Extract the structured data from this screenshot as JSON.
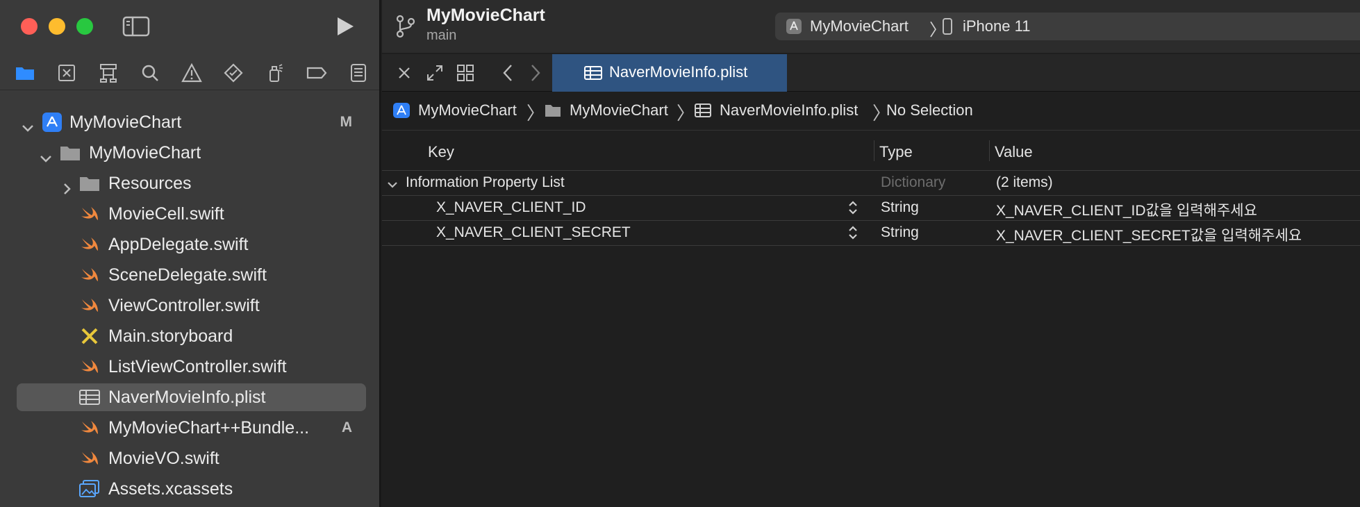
{
  "sidebar": {
    "nav_icons": [
      "folder-icon",
      "source-control-icon",
      "hierarchy-icon",
      "search-icon",
      "warning-icon",
      "test-diamond-icon",
      "debug-spray-icon",
      "breakpoint-icon",
      "report-icon"
    ],
    "tree": [
      {
        "label": "MyMovieChart",
        "icon": "xcode-project-icon",
        "badge": "M",
        "expanded": true
      },
      {
        "label": "MyMovieChart",
        "icon": "folder-icon",
        "expanded": true
      },
      {
        "label": "Resources",
        "icon": "folder-icon",
        "expanded": false
      },
      {
        "label": "MovieCell.swift",
        "icon": "swift-icon"
      },
      {
        "label": "AppDelegate.swift",
        "icon": "swift-icon"
      },
      {
        "label": "SceneDelegate.swift",
        "icon": "swift-icon"
      },
      {
        "label": "ViewController.swift",
        "icon": "swift-icon"
      },
      {
        "label": "Main.storyboard",
        "icon": "storyboard-icon"
      },
      {
        "label": "ListViewController.swift",
        "icon": "swift-icon"
      },
      {
        "label": "NaverMovieInfo.plist",
        "icon": "plist-icon",
        "selected": true
      },
      {
        "label": "MyMovieChart++Bundle...",
        "icon": "swift-icon",
        "badge": "A"
      },
      {
        "label": "MovieVO.swift",
        "icon": "swift-icon"
      },
      {
        "label": "Assets.xcassets",
        "icon": "assets-icon"
      }
    ]
  },
  "toolbar": {
    "project": "MyMovieChart",
    "branch": "main",
    "scheme": "MyMovieChart",
    "device": "iPhone 11"
  },
  "tab": {
    "label": "NaverMovieInfo.plist"
  },
  "jumpbar": {
    "crumbs": [
      "MyMovieChart",
      "MyMovieChart",
      "NaverMovieInfo.plist",
      "No Selection"
    ]
  },
  "plist": {
    "headers": {
      "key": "Key",
      "type": "Type",
      "value": "Value"
    },
    "root": {
      "key": "Information Property List",
      "type": "Dictionary",
      "value": "(2 items)"
    },
    "rows": [
      {
        "key": "X_NAVER_CLIENT_ID",
        "type": "String",
        "value": "X_NAVER_CLIENT_ID값을 입력해주세요"
      },
      {
        "key": "X_NAVER_CLIENT_SECRET",
        "type": "String",
        "value": "X_NAVER_CLIENT_SECRET값을 입력해주세요"
      }
    ]
  },
  "colors": {
    "swift": "#f0883e",
    "folder": "#9a9a9a",
    "accent_tab": "#2f5481",
    "project_icon": "#2f7ff6"
  }
}
